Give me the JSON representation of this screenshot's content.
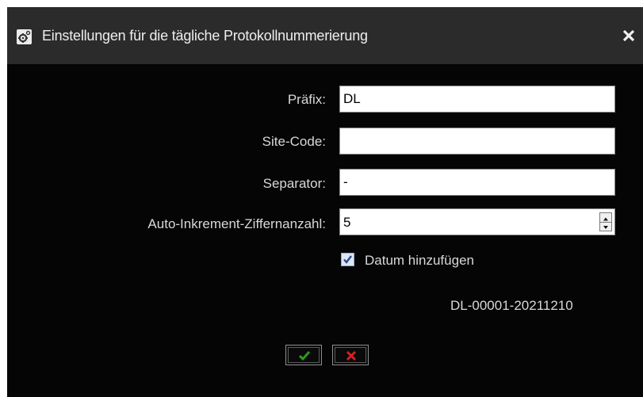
{
  "dialog": {
    "title": "Einstellungen für die tägliche Protokollnummerierung"
  },
  "form": {
    "prefix_label": "Präfix:",
    "prefix_value": "DL",
    "site_code_label": "Site-Code:",
    "site_code_value": "",
    "separator_label": "Separator:",
    "separator_value": "-",
    "digits_label": "Auto-Inkrement-Ziffernanzahl:",
    "digits_value": "5",
    "add_date_label": "Datum hinzufügen",
    "add_date_checked": true,
    "preview": "DL-00001-20211210"
  },
  "icons": {
    "title": "settings-gear-icon",
    "close": "close-icon",
    "confirm": "checkmark-icon",
    "cancel": "x-icon"
  },
  "colors": {
    "background": "#050505",
    "titlebar": "#2b2b2b",
    "text": "#d8d8d8",
    "confirm": "#2f9a1e",
    "cancel": "#d62020"
  }
}
